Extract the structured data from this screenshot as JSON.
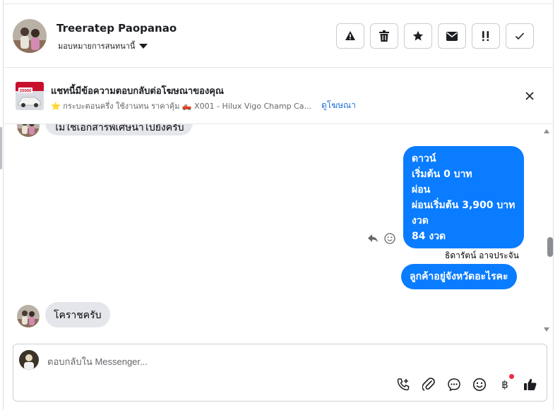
{
  "header": {
    "name": "Treeratep Paopanao",
    "assign_label": "มอบหมายการสนทนานี้",
    "actions": [
      {
        "icon": "warning-icon"
      },
      {
        "icon": "trash-icon"
      },
      {
        "icon": "star-icon"
      },
      {
        "icon": "mail-icon"
      },
      {
        "icon": "follow-up-icon"
      },
      {
        "icon": "check-icon"
      }
    ]
  },
  "ad": {
    "thumb_text": "20000",
    "title": "แชทนี้มีข้อความตอบกลับต่อโฆษณาของคุณ",
    "subtitle": "⭐ กระบะตอนครึ่ง ใช้งานทน ราคาคุ้ม 🛻 X001 - Hilux Vigo Champ Ca...",
    "link": "ดูโฆษณา"
  },
  "messages": {
    "cut_text": "ไม่ใช่เอกสารพิเศษนำไปยังครับ",
    "outgoing_lines": [
      "ดาวน์",
      "เริ่มต้น 0 บาท",
      "ผ่อน",
      "ผ่อนเริ่มต้น 3,900 บาท",
      "งวด",
      "84 งวด"
    ],
    "sender": "ธิดารัตน์ อาจประจัน",
    "outgoing_2": "ลูกค้าอยู่จังหวัดอะไรคะ",
    "incoming_2": "โคราชครับ"
  },
  "composer": {
    "placeholder": "ตอบกลับใน Messenger..."
  },
  "colors": {
    "accent": "#0a7cff",
    "link": "#216fdb",
    "notification": "#f02849"
  }
}
